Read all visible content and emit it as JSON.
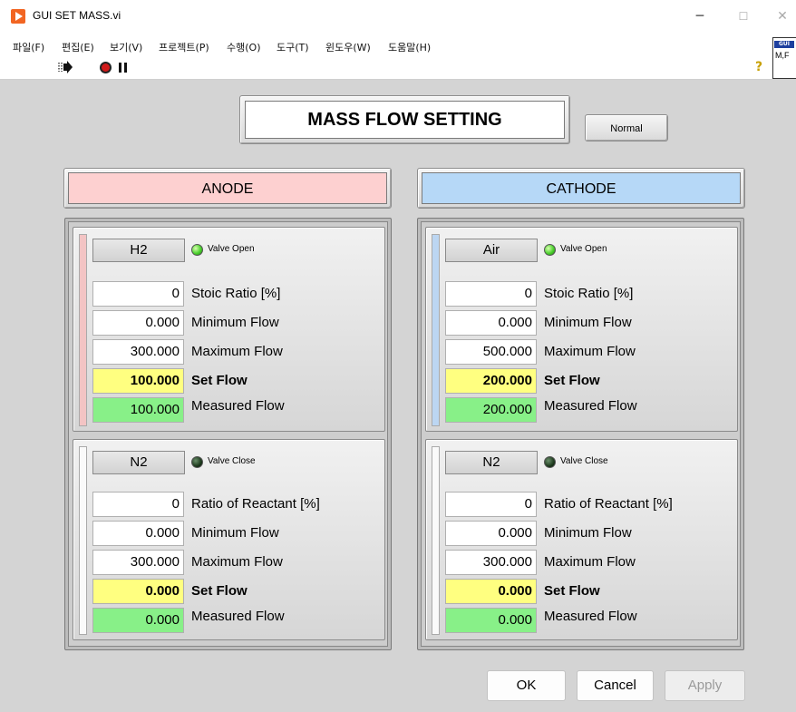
{
  "window": {
    "title": "GUI SET MASS.vi",
    "min_label": "─",
    "max_label": "☐",
    "close_label": "✕"
  },
  "menu": [
    "파일(F)",
    "편집(E)",
    "보기(V)",
    "프로젝트(P)",
    "수행(O)",
    "도구(T)",
    "윈도우(W)",
    "도움말(H)"
  ],
  "toolbar": {
    "help_label": "?",
    "vi_icon_top": "GUI",
    "vi_icon_label": "M,F"
  },
  "panel": {
    "title": "MASS FLOW SETTING",
    "mode_button": "Normal",
    "anode": {
      "header": "ANODE",
      "primary": {
        "gas": "H2",
        "valve_state": "on",
        "valve_text": "Valve Open",
        "ratio_value": "0",
        "ratio_label": "Stoic Ratio [%]",
        "min_value": "0.000",
        "min_label": "Minimum Flow",
        "max_value": "300.000",
        "max_label": "Maximum Flow",
        "set_value": "100.000",
        "set_label": "Set Flow",
        "measured_value": "100.000",
        "measured_label": "Measured Flow"
      },
      "purge": {
        "gas": "N2",
        "valve_state": "off",
        "valve_text": "Valve Close",
        "ratio_value": "0",
        "ratio_label": "Ratio of Reactant [%]",
        "min_value": "0.000",
        "min_label": "Minimum Flow",
        "max_value": "300.000",
        "max_label": "Maximum Flow",
        "set_value": "0.000",
        "set_label": "Set Flow",
        "measured_value": "0.000",
        "measured_label": "Measured Flow"
      }
    },
    "cathode": {
      "header": "CATHODE",
      "primary": {
        "gas": "Air",
        "valve_state": "on",
        "valve_text": "Valve Open",
        "ratio_value": "0",
        "ratio_label": "Stoic Ratio [%]",
        "min_value": "0.000",
        "min_label": "Minimum Flow",
        "max_value": "500.000",
        "max_label": "Maximum Flow",
        "set_value": "200.000",
        "set_label": "Set Flow",
        "measured_value": "200.000",
        "measured_label": "Measured Flow"
      },
      "purge": {
        "gas": "N2",
        "valve_state": "off",
        "valve_text": "Valve Close",
        "ratio_value": "0",
        "ratio_label": "Ratio of Reactant [%]",
        "min_value": "0.000",
        "min_label": "Minimum Flow",
        "max_value": "300.000",
        "max_label": "Maximum Flow",
        "set_value": "0.000",
        "set_label": "Set Flow",
        "measured_value": "0.000",
        "measured_label": "Measured Flow"
      }
    }
  },
  "buttons": {
    "ok": "OK",
    "cancel": "Cancel",
    "apply": "Apply"
  },
  "colors": {
    "anode_header": "#fdd0d0",
    "cathode_header": "#b6d8f7",
    "set_field": "#ffff80",
    "measured_field": "#88f088",
    "led_on": "#4cd12f"
  }
}
